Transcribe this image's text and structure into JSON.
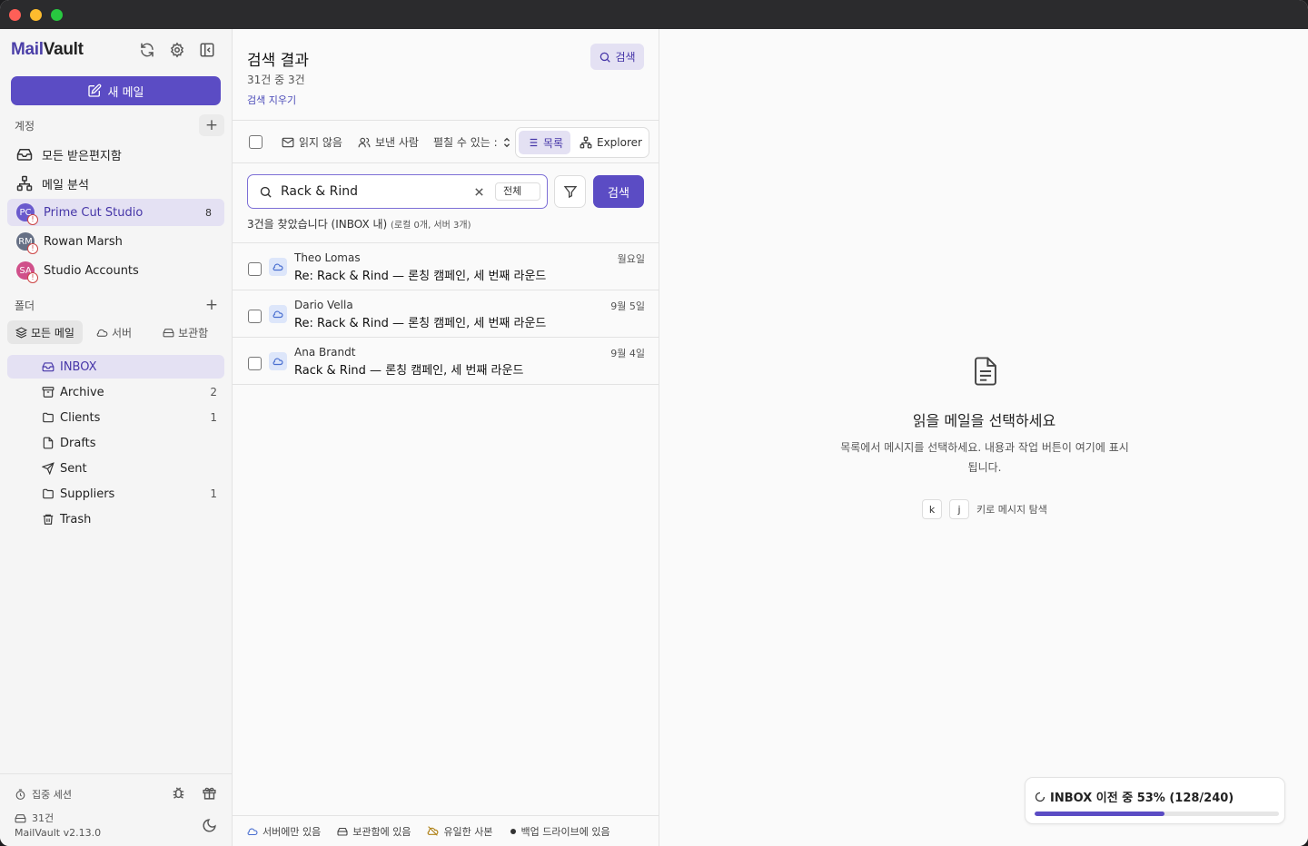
{
  "app": {
    "logo_prefix": "Mail",
    "logo_suffix": "Vault",
    "new_mail": "새 메일"
  },
  "accounts": {
    "label": "계정",
    "items": [
      {
        "label": "모든 받은편지함",
        "icon": "inbox-icon"
      },
      {
        "label": "메일 분석",
        "icon": "analytics-icon"
      },
      {
        "label": "Prime Cut Studio",
        "initials": "PC",
        "count": "8",
        "color": "#6a5acd",
        "active": true
      },
      {
        "label": "Rowan Marsh",
        "initials": "RM",
        "color": "#667085"
      },
      {
        "label": "Studio Accounts",
        "initials": "SA",
        "color": "#d0508a"
      }
    ]
  },
  "folders": {
    "label": "폴더",
    "tabs": [
      "모든 메일",
      "서버",
      "보관함"
    ],
    "items": [
      {
        "label": "INBOX",
        "count": "",
        "icon": "inbox-icon",
        "active": true
      },
      {
        "label": "Archive",
        "count": "2",
        "icon": "archive-icon"
      },
      {
        "label": "Clients",
        "count": "1",
        "icon": "folder-icon"
      },
      {
        "label": "Drafts",
        "count": "",
        "icon": "draft-icon"
      },
      {
        "label": "Sent",
        "count": "",
        "icon": "send-icon"
      },
      {
        "label": "Suppliers",
        "count": "1",
        "icon": "folder-icon"
      },
      {
        "label": "Trash",
        "count": "",
        "icon": "trash-icon"
      }
    ]
  },
  "sidebar_footer": {
    "focus_session": "집중 세션",
    "count": "31건",
    "version": "MailVault v2.13.0"
  },
  "results": {
    "title": "검색 결과",
    "subtitle": "31건 중 3건",
    "clear": "검색 지우기",
    "search_button": "검색"
  },
  "toolbar": {
    "unread": "읽지 않음",
    "sender": "보낸 사람",
    "expand": "펼칠 수 있는 :",
    "view_list": "목록",
    "view_explorer": "Explorer"
  },
  "search": {
    "query": "Rack & Rind",
    "scope": "전체",
    "submit": "검색",
    "info_main": "3건을 찾았습니다 (INBOX 내)",
    "info_detail": "(로컬 0개, 서버 3개)"
  },
  "messages": [
    {
      "from": "Theo Lomas",
      "subject": "Re: Rack & Rind — 론칭 캠페인, 세 번째 라운드",
      "date": "월요일"
    },
    {
      "from": "Dario Vella",
      "subject": "Re: Rack & Rind — 론칭 캠페인, 세 번째 라운드",
      "date": "9월 5일"
    },
    {
      "from": "Ana Brandt",
      "subject": "Rack & Rind — 론칭 캠페인, 세 번째 라운드",
      "date": "9월 4일"
    }
  ],
  "legend": [
    "서버에만 있음",
    "보관함에 있음",
    "유일한 사본",
    "백업 드라이브에 있음"
  ],
  "reader": {
    "title": "읽을 메일을 선택하세요",
    "description": "목록에서 메시지를 선택하세요. 내용과 작업 버튼이 여기에 표시됩니다.",
    "key_k": "k",
    "key_j": "j",
    "key_hint": "키로 메시지 탐색"
  },
  "migration": {
    "text": "INBOX 이전 중 53% (128/240)",
    "progress": 0.53
  },
  "colors": {
    "accent": "#5b4cc4",
    "accent_soft": "#e4e1f3"
  }
}
